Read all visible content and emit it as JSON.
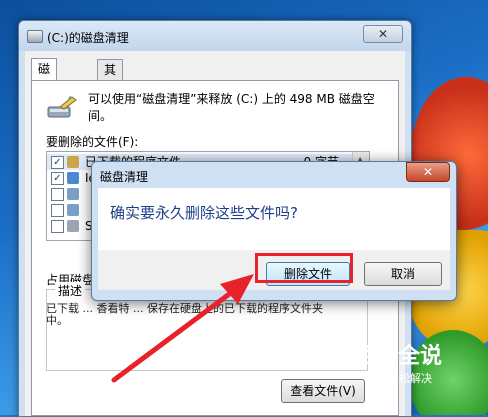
{
  "main_window": {
    "title": "(C:)的磁盘清理",
    "close_label": "✕",
    "tabs": [
      {
        "label": "磁盘清理",
        "active": true
      },
      {
        "label": "其他选项",
        "active": false
      }
    ],
    "description": "可以使用“磁盘清理”来释放 (C:) 上的 498 MB 磁盘空间。",
    "list_label": "要删除的文件(F):",
    "files": [
      {
        "name": "已下载的程序文件",
        "size": "0 字节",
        "checked": true
      },
      {
        "name": "Ie",
        "size": "",
        "checked": true
      },
      {
        "name": "",
        "size": "",
        "checked": false
      },
      {
        "name": "",
        "size": "",
        "checked": false
      },
      {
        "name": "S",
        "size": "",
        "checked": false
      }
    ],
    "occupied_label": "占用磁盘",
    "describe_title": "描述",
    "describe_text": "已下载 ... 香看特 ... 保存在硬盘上的已下载的程序文件夹中。",
    "view_files_button": "查看文件(V)"
  },
  "dialog": {
    "title": "磁盘清理",
    "close_label": "✕",
    "message": "确实要永久删除这些文件吗?",
    "delete_button": "删除文件",
    "cancel_button": "取消"
  },
  "watermark": {
    "main": "百科全说",
    "sub": "助你轻松解决"
  },
  "colors": {
    "highlight": "#e8212a",
    "arrow": "#e8212a",
    "dialog_message": "#1d3f8a"
  }
}
